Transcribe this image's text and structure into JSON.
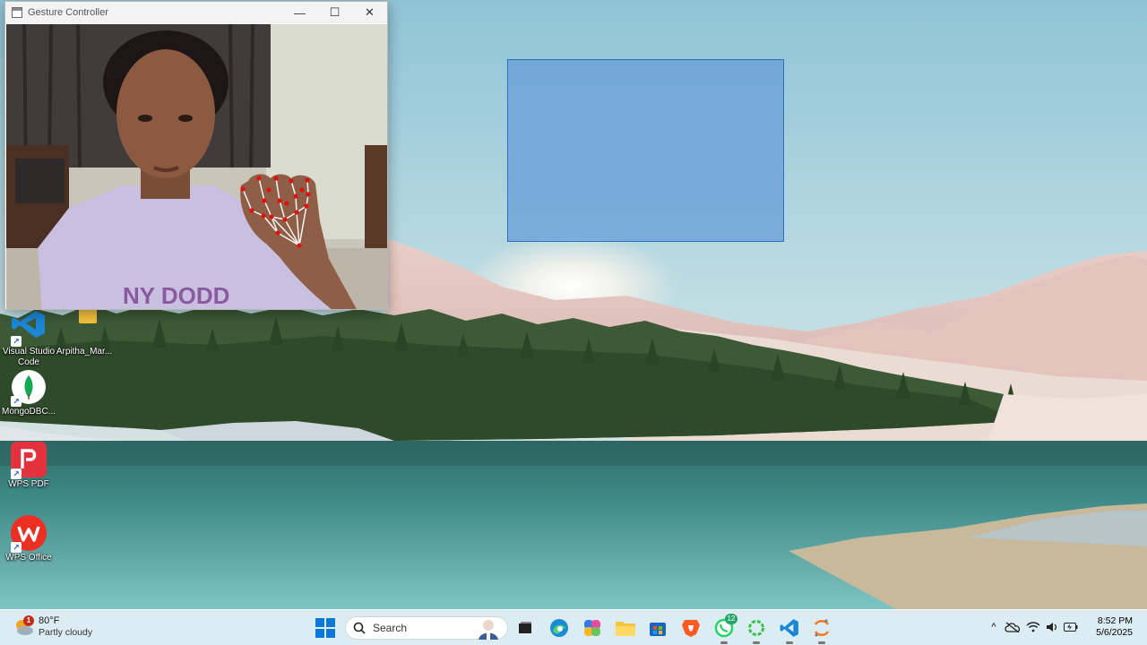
{
  "window": {
    "title": "Gesture Controller",
    "minimize_glyph": "—",
    "maximize_glyph": "☐",
    "close_glyph": "✕"
  },
  "desktop_icons": [
    {
      "label": "Visual Studio Code",
      "icon": "vscode-icon"
    },
    {
      "label": "Arpitha_Mar...",
      "icon": "folder-icon"
    },
    {
      "label": "MongoDBC...",
      "icon": "mongodb-icon"
    },
    {
      "label": "WPS PDF",
      "icon": "wps-pdf-icon"
    },
    {
      "label": "WPS Office",
      "icon": "wps-office-icon"
    }
  ],
  "taskbar": {
    "weather": {
      "temperature": "80°F",
      "condition": "Partly cloudy",
      "badge": "1"
    },
    "search": {
      "placeholder": "Search"
    },
    "apps": [
      {
        "name": "start",
        "icon": "windows-start-icon"
      },
      {
        "name": "task-view",
        "icon": "task-view-icon"
      },
      {
        "name": "edge",
        "icon": "edge-icon"
      },
      {
        "name": "copilot",
        "icon": "copilot-icon"
      },
      {
        "name": "file-explorer",
        "icon": "folder-icon"
      },
      {
        "name": "store",
        "icon": "store-icon"
      },
      {
        "name": "brave",
        "icon": "brave-icon"
      },
      {
        "name": "whatsapp",
        "icon": "whatsapp-icon",
        "badge": "12"
      },
      {
        "name": "loading",
        "icon": "loading-ring-icon"
      },
      {
        "name": "vscode",
        "icon": "vscode-icon"
      },
      {
        "name": "jupyter",
        "icon": "jupyter-icon"
      }
    ],
    "clock": {
      "time": "8:52 PM",
      "date": "5/6/2025"
    }
  },
  "colors": {
    "selection_fill": "#649bd7",
    "taskbar_bg": "#deeef2",
    "landmark_dot": "#e01010"
  }
}
